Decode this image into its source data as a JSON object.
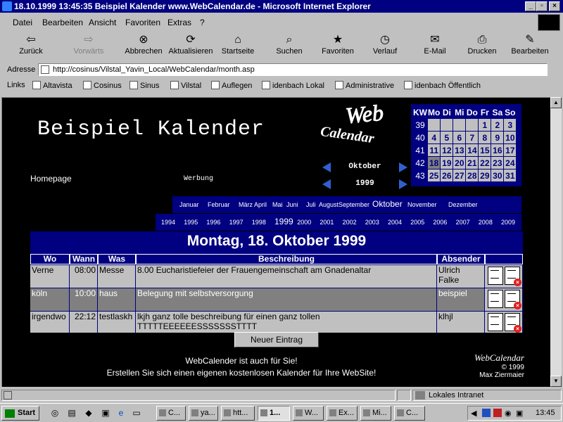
{
  "window": {
    "title": "18.10.1999 13:45:35 Beispiel Kalender www.WebCalendar.de - Microsoft Internet Explorer"
  },
  "menu": [
    "Datei",
    "Bearbeiten",
    "Ansicht",
    "Favoriten",
    "Extras",
    "?"
  ],
  "toolbar": [
    {
      "label": "Zurück",
      "icon": "back-arrow-icon"
    },
    {
      "label": "Vorwärts",
      "icon": "forward-arrow-icon"
    },
    {
      "label": "Abbrechen",
      "icon": "stop-icon"
    },
    {
      "label": "Aktualisieren",
      "icon": "refresh-icon"
    },
    {
      "label": "Startseite",
      "icon": "home-icon"
    },
    {
      "label": "Suchen",
      "icon": "search-icon"
    },
    {
      "label": "Favoriten",
      "icon": "favorites-icon"
    },
    {
      "label": "Verlauf",
      "icon": "history-icon"
    },
    {
      "label": "E-Mail",
      "icon": "mail-icon"
    },
    {
      "label": "Drucken",
      "icon": "printer-icon"
    },
    {
      "label": "Bearbeiten",
      "icon": "edit-icon"
    }
  ],
  "address": {
    "label": "Adresse",
    "url": "http://cosinus/Vilstal_Yavin_Local/WebCalendar/month.asp"
  },
  "links": {
    "label": "Links",
    "items": [
      "Altavista",
      "Cosinus",
      "Sinus",
      "Vilstal",
      "Auflegen",
      "idenbach Lokal",
      "Administrative",
      "idenbach Öffentlich"
    ]
  },
  "page": {
    "title": "Beispiel Kalender",
    "logo_web": "Web",
    "logo_calendar": "Calendar",
    "homepage": "Homepage",
    "werbung": "Werbung",
    "nav_month": "Oktober",
    "nav_year": "1999",
    "minical": {
      "headers": [
        "KW",
        "Mo",
        "Di",
        "Mi",
        "Do",
        "Fr",
        "Sa",
        "So"
      ],
      "weeks": [
        {
          "kw": "39",
          "days": [
            "",
            "",
            "",
            "",
            "1",
            "2",
            "3"
          ]
        },
        {
          "kw": "40",
          "days": [
            "4",
            "5",
            "6",
            "7",
            "8",
            "9",
            "10"
          ]
        },
        {
          "kw": "41",
          "days": [
            "11",
            "12",
            "13",
            "14",
            "15",
            "16",
            "17"
          ]
        },
        {
          "kw": "42",
          "days": [
            "18",
            "19",
            "20",
            "21",
            "22",
            "23",
            "24"
          ]
        },
        {
          "kw": "43",
          "days": [
            "25",
            "26",
            "27",
            "28",
            "29",
            "30",
            "31"
          ]
        }
      ],
      "today": "18"
    },
    "months": [
      "Januar",
      "Februar",
      "März",
      "April",
      "Mai",
      "Juni",
      "Juli",
      "August",
      "September",
      "Oktober",
      "November",
      "Dezember"
    ],
    "current_month": "Oktober",
    "years": [
      "1994",
      "1995",
      "1996",
      "1997",
      "1998",
      "1999",
      "2000",
      "2001",
      "2002",
      "2003",
      "2004",
      "2005",
      "2006",
      "2007",
      "2008",
      "2009"
    ],
    "current_year": "1999",
    "day_title": "Montag, 18. Oktober 1999",
    "columns": [
      "Wo",
      "Wann",
      "Was",
      "Beschreibung",
      "Absender"
    ],
    "rows": [
      {
        "wo": "Verne",
        "wann": "08:00",
        "was": "Messe",
        "desc1": "8.00 Eucharistiefeier der Frauengemeinschaft am Gnadenaltar",
        "desc2": "",
        "abs1": "Ulrich",
        "abs2": "Falke"
      },
      {
        "wo": "köln",
        "wann": "10:00",
        "was": "haus",
        "desc1": "Belegung mit selbstversorgung",
        "desc2": "",
        "abs1": "beispiel",
        "abs2": ""
      },
      {
        "wo": "irgendwo",
        "wann": "22:12",
        "was": "testlaskh",
        "desc1": "lkjh ganz tolle beschreibung für einen ganz tollen",
        "desc2": "TTTTTEEEEEESSSSSSSTTTT",
        "abs1": "klhjl",
        "abs2": ""
      }
    ],
    "new_entry": "Neuer Eintrag",
    "footer_line1": "WebCalender ist auch für Sie!",
    "footer_line2": "Erstellen Sie sich einen eigenen kostenlosen Kalender für Ihre WebSite!",
    "wc_logo": "WebCalendar",
    "wc_year": "© 1999",
    "wc_author": "Max Ziermaier"
  },
  "status": {
    "zone": "Lokales Intranet"
  },
  "taskbar": {
    "start": "Start",
    "tasks": [
      "C...",
      "ya...",
      "htt...",
      "1...",
      "W...",
      "Ex...",
      "Mi...",
      "C..."
    ],
    "clock": "13:45"
  }
}
